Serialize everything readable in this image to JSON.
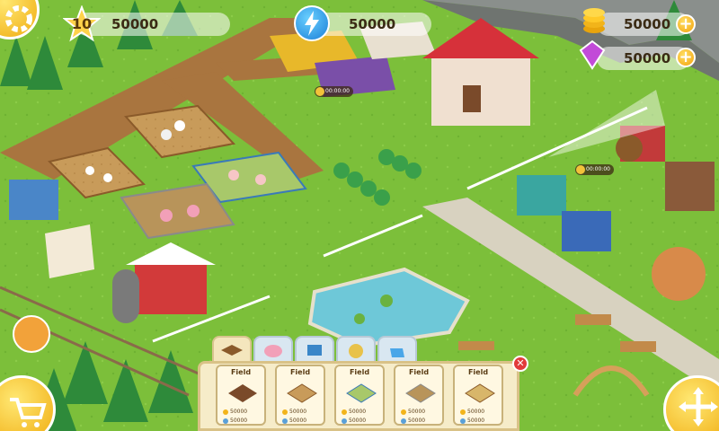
{
  "hud": {
    "level": "10",
    "xp": "50000",
    "energy": "50000",
    "coins": "50000",
    "gems": "50000"
  },
  "build_menu": {
    "tabs": [
      "fields",
      "animals",
      "machines",
      "crops",
      "decor"
    ],
    "active_tab": 0,
    "items": [
      {
        "title": "Field",
        "price": "50000",
        "time": "50000"
      },
      {
        "title": "Field",
        "price": "50000",
        "time": "50000"
      },
      {
        "title": "Field",
        "price": "50000",
        "time": "50000"
      },
      {
        "title": "Field",
        "price": "50000",
        "time": "50000"
      },
      {
        "title": "Field",
        "price": "50000",
        "time": "50000"
      }
    ],
    "close_label": "✕"
  },
  "timers": {
    "crop": "00:00:00",
    "machine": "00:00:00"
  },
  "icons": {
    "settings": "gear-icon",
    "shop": "cart-icon",
    "move": "move-arrows-icon",
    "level": "star-icon",
    "energy": "lightning-icon",
    "coins": "coin-stack-icon",
    "gems": "gem-icon"
  },
  "colors": {
    "grass": "#7cbf3a",
    "path": "#9a6a3a",
    "accent": "#f2a10c",
    "panel": "#f6ecc9"
  }
}
